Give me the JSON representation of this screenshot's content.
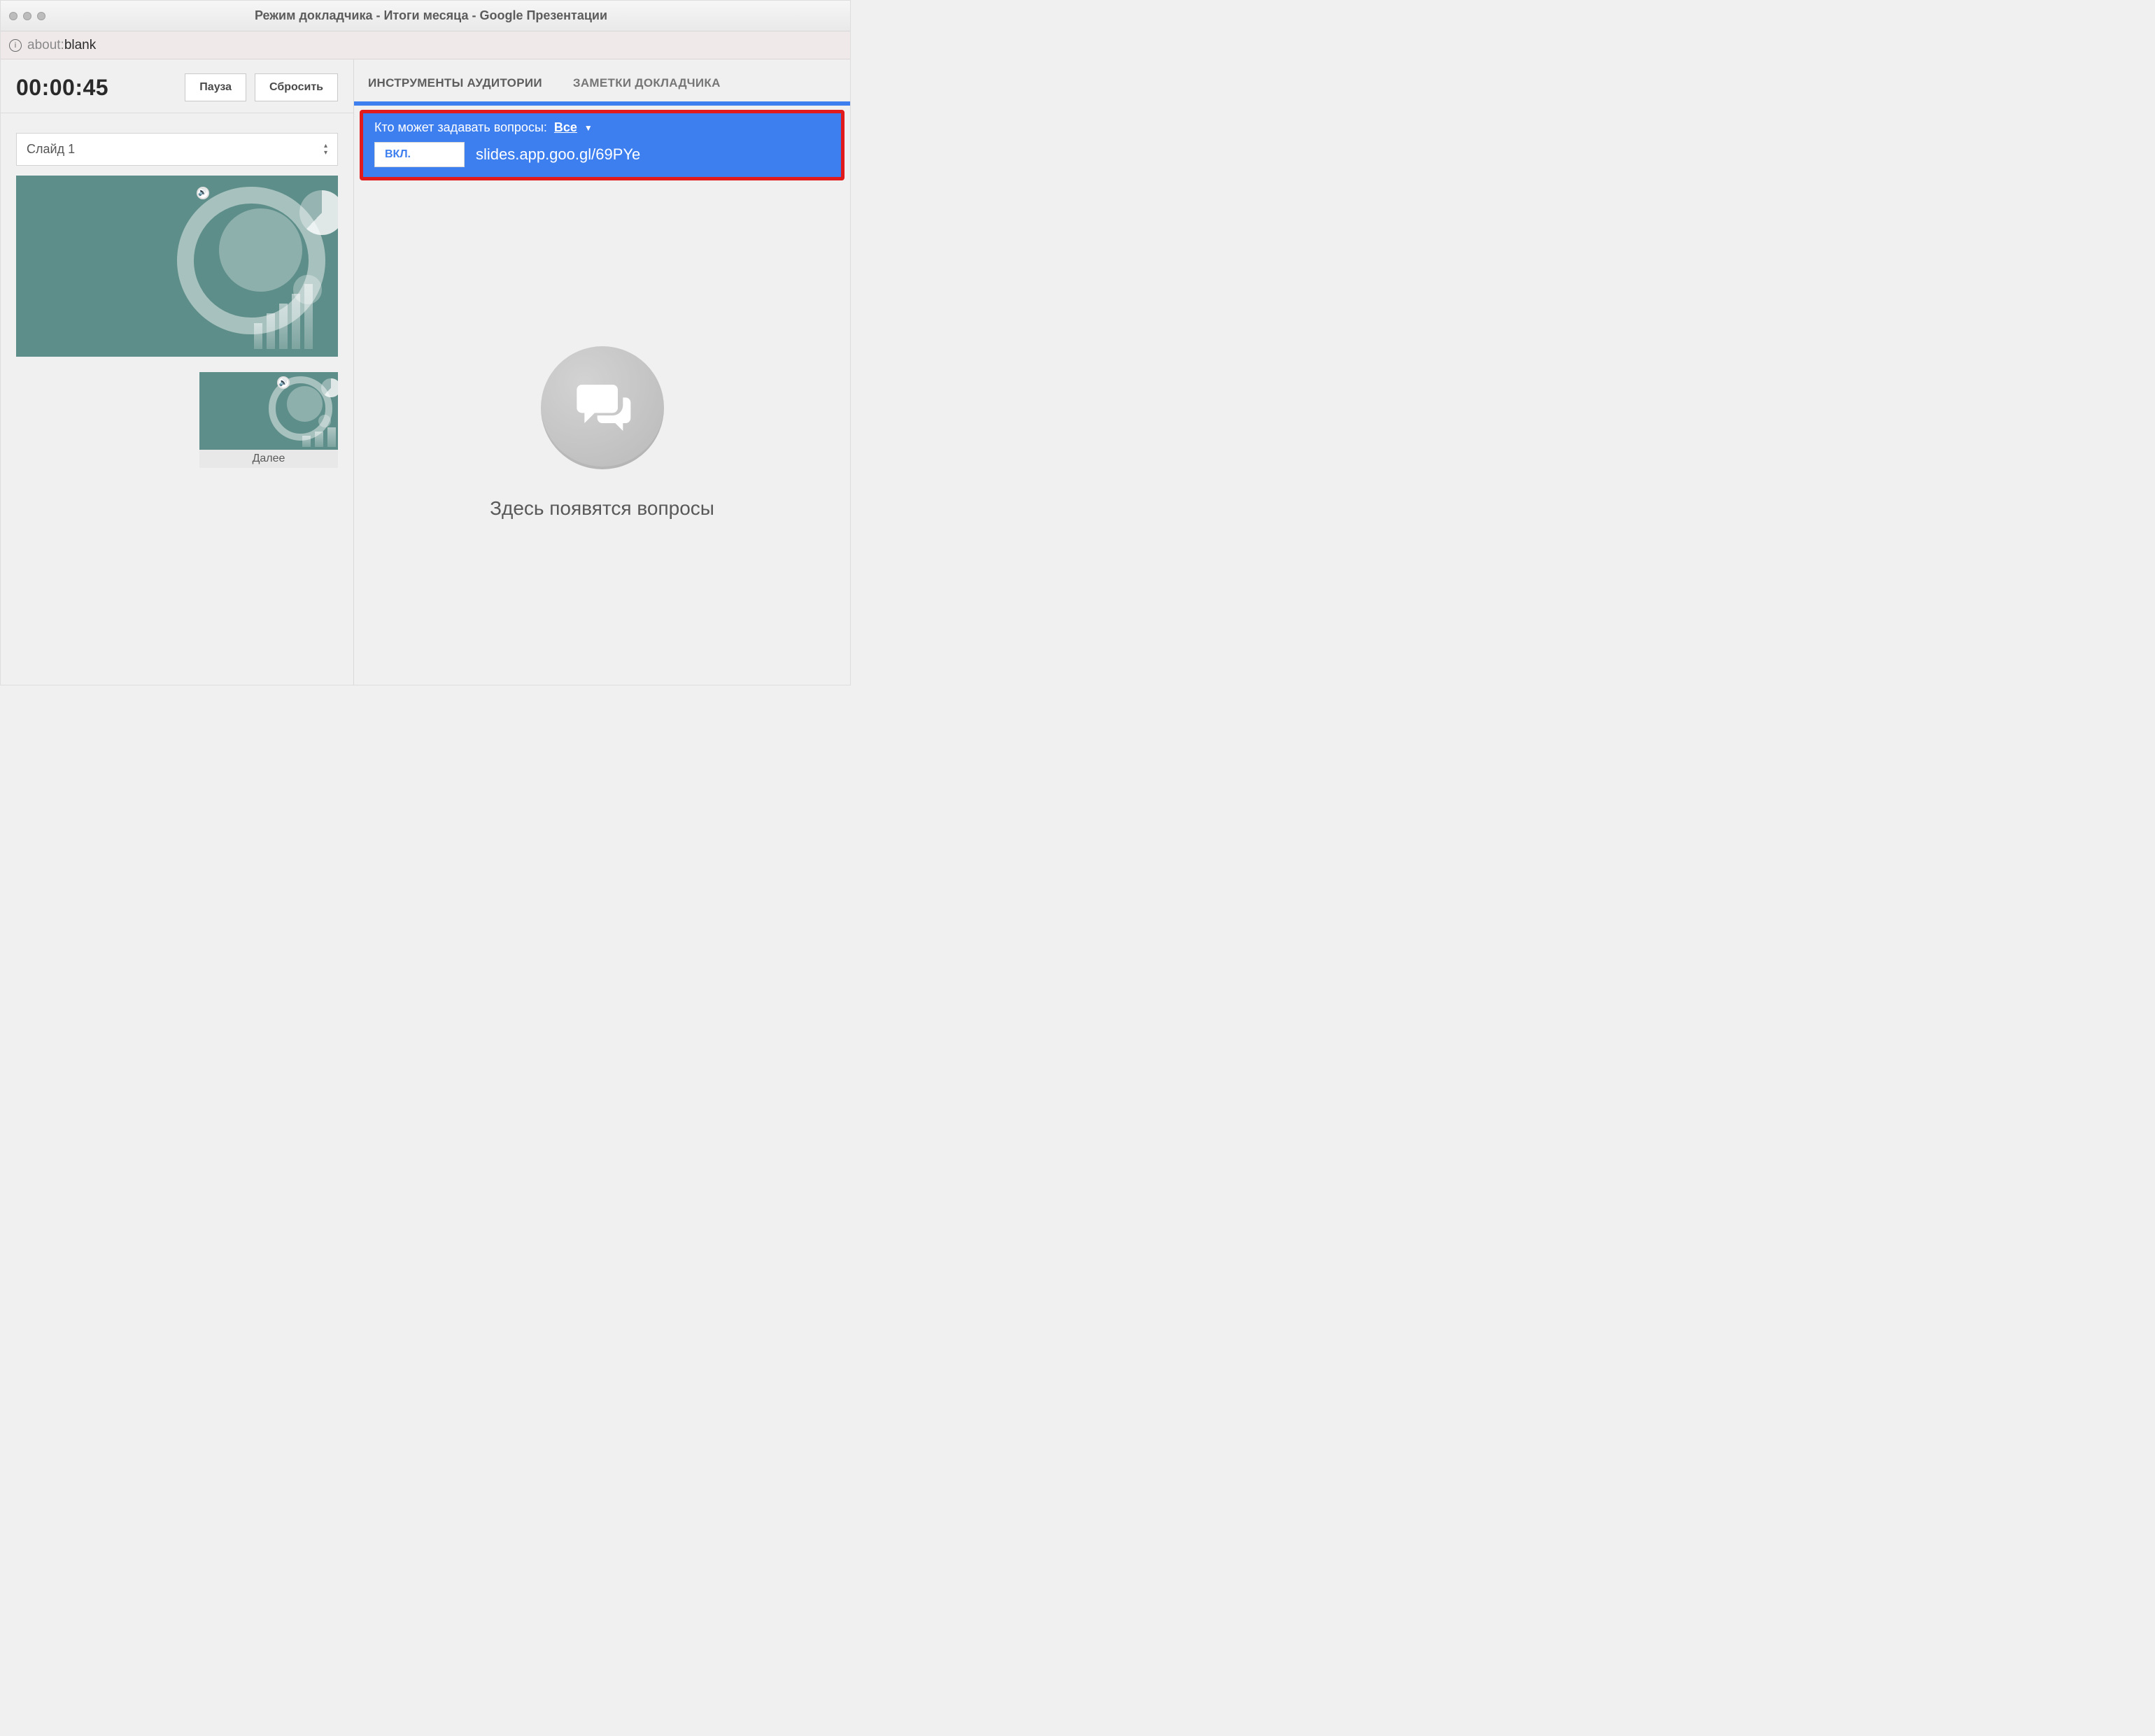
{
  "window": {
    "title": "Режим докладчика - Итоги месяца - Google Презентации"
  },
  "address": {
    "scheme": "about:",
    "path": "blank"
  },
  "timer": {
    "value": "00:00:45",
    "pause_label": "Пауза",
    "reset_label": "Сбросить"
  },
  "slide_picker": {
    "label": "Слайд 1"
  },
  "next": {
    "caption": "Далее"
  },
  "tabs": {
    "audience": "ИНСТРУМЕНТЫ АУДИТОРИИ",
    "notes": "ЗАМЕТКИ ДОКЛАДЧИКА",
    "active": "audience"
  },
  "audience": {
    "who_label": "Кто может задавать вопросы:",
    "who_value": "Все",
    "toggle_on": "ВКЛ.",
    "url": "slides.app.goo.gl/69PYe"
  },
  "questions": {
    "empty": "Здесь появятся вопросы"
  }
}
